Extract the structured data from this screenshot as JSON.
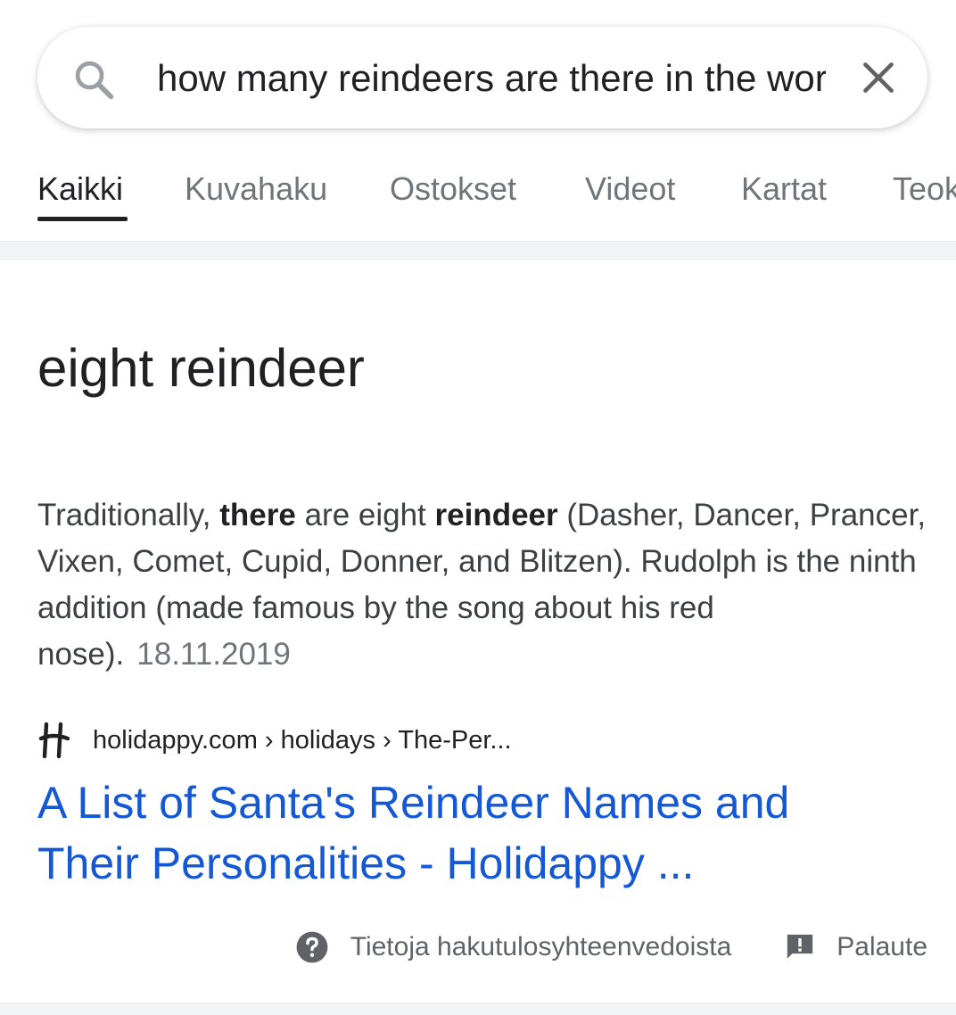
{
  "search": {
    "query": "how many reindeers are there in the wor"
  },
  "tabs": [
    {
      "label": "Kaikki",
      "active": true
    },
    {
      "label": "Kuvahaku",
      "active": false
    },
    {
      "label": "Ostokset",
      "active": false
    },
    {
      "label": "Videot",
      "active": false
    },
    {
      "label": "Kartat",
      "active": false
    },
    {
      "label": "Teok",
      "active": false
    }
  ],
  "featured": {
    "answer": "eight reindeer",
    "snippet": {
      "part1": "Traditionally, ",
      "bold1": "there",
      "part2": " are eight ",
      "bold2": "reindeer",
      "part3": " (Dasher, Dancer, Prancer, Vixen, Comet, Cupid, Donner, and Blitzen). Rudolph is the ninth addition (made famous by the song about his red nose).",
      "date": "18.11.2019"
    },
    "source": {
      "breadcrumb": "holidappy.com › holidays › The-Per..."
    },
    "link": {
      "line1": "A List of Santa's Reindeer Names and",
      "line2": "Their Personalities - Holidappy ..."
    }
  },
  "footer": {
    "about_label": "Tietoja hakutulosyhteenvedoista",
    "feedback_label": "Palaute"
  },
  "colors": {
    "link": "#1558d6",
    "muted": "#70757a",
    "text": "#202124"
  }
}
